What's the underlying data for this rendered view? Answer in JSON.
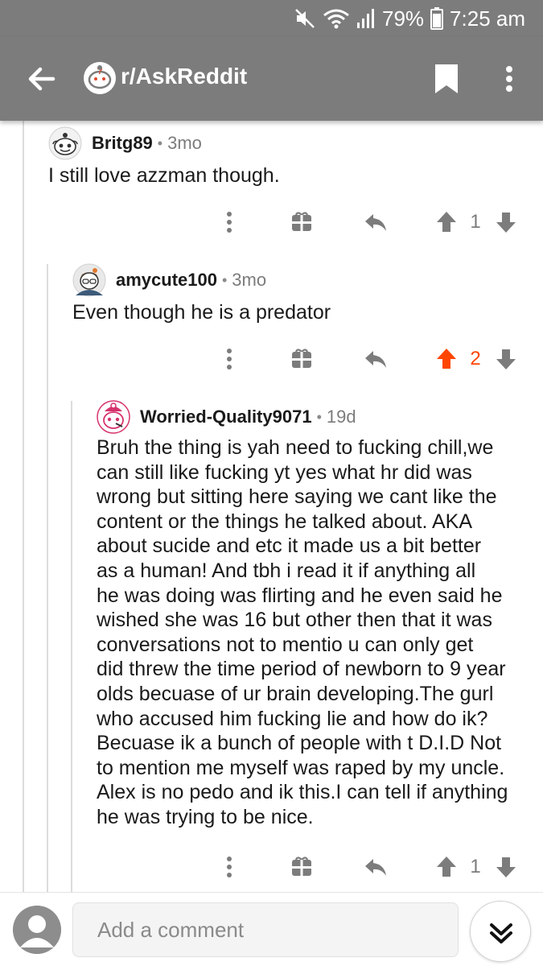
{
  "status_bar": {
    "battery": "79%",
    "time": "7:25 am"
  },
  "app_bar": {
    "subreddit": "r/AskReddit"
  },
  "comments": [
    {
      "author": "Britg89",
      "age": "3mo",
      "body": "I still love azzman though.",
      "score": "1",
      "upvoted": false
    },
    {
      "author": "amycute100",
      "age": "3mo",
      "body": "Even though he is a predator",
      "score": "2",
      "upvoted": true
    },
    {
      "author": "Worried-Quality9071",
      "age": "19d",
      "body_lines": [
        "Bruh the thing is yah need to fucking chill,we",
        "can still like  fucking yt yes what hr did was",
        "wrong but sitting here saying we cant like the",
        "content or the things he talked about. AKA",
        "about sucide and etc it made us a bit better",
        "as a human! And tbh i read it if anything all",
        "he was doing was flirting and he even said he",
        "wished she was 16 but other then that it was",
        "conversations not to mentio  u can only get",
        "did threw the time period of newborn to 9 year",
        "olds becuase of ur brain developing.The gurl",
        "who accused him fucking lie and how do ik?",
        "Becuase ik a bunch of people with t D.I.D Not",
        "to mention me myself was raped by my uncle.",
        "Alex is no pedo and ik this.I can tell if anything",
        "he was trying to be nice."
      ],
      "score": "1",
      "upvoted": false
    }
  ],
  "bottom_bar": {
    "placeholder": "Add a comment"
  },
  "colors": {
    "header": "#7c7c7c",
    "upvote_active": "#ff4500",
    "icon": "#7c7c7c"
  }
}
